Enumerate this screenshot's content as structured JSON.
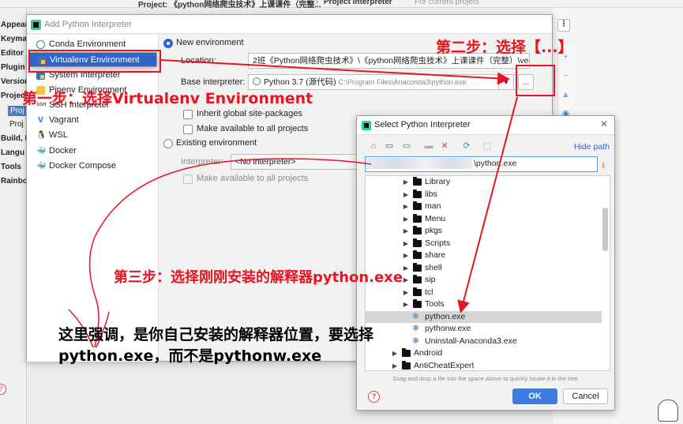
{
  "background": {
    "project_title": "Project: 《python网络爬虫技术》上课课件（完整...",
    "title_separator": "›",
    "project_interpreter_title": "Project Interpreter",
    "for_current_project": "For current project",
    "left_items": [
      "Appear",
      "Keyma",
      "Editor",
      "Plugin",
      "Version",
      "Project",
      "Proj",
      "Proj",
      "Build, E",
      "Langu",
      "Tools",
      "Rainbo"
    ]
  },
  "add_dialog": {
    "title": "Add Python Interpreter",
    "types": [
      {
        "label": "Conda Environment",
        "icon": "conda-icon"
      },
      {
        "label": "Virtualenv Environment",
        "icon": "virtualenv-icon",
        "selected": true
      },
      {
        "label": "System Interpreter",
        "icon": "python-icon"
      },
      {
        "label": "Pipenv Environment",
        "icon": "pipenv-icon"
      },
      {
        "label": "SSH Interpreter",
        "icon": "ssh-icon"
      },
      {
        "label": "Vagrant",
        "icon": "vagrant-icon"
      },
      {
        "label": "WSL",
        "icon": "wsl-icon"
      },
      {
        "label": "Docker",
        "icon": "docker-icon"
      },
      {
        "label": "Docker Compose",
        "icon": "docker-compose-icon"
      }
    ],
    "new_env_label": "New environment",
    "location_label": "Location:",
    "location_value": "2班《Python网络爬虫技术》\\《python网络爬虫技术》上课课件（完整）\\venv",
    "base_interpreter_label": "Base interpreter:",
    "base_interpreter_value": "Python 3.7 (源代码)",
    "base_interpreter_path": "C:\\Program Files\\Anaconda3\\python.exe",
    "browse_label": "...",
    "inherit_label": "Inherit global site-packages",
    "make_available_label": "Make available to all projects",
    "existing_env_label": "Existing environment",
    "interpreter_label": "Interpreter:",
    "interpreter_value": "<No interpreter>",
    "make_available_label_2": "Make available to all projects"
  },
  "select_dialog": {
    "title": "Select Python Interpreter",
    "hide_path_label": "Hide path",
    "path_value": "\\python.exe",
    "tree": [
      {
        "name": "Library",
        "kind": "folder",
        "indent": 1
      },
      {
        "name": "libs",
        "kind": "folder",
        "indent": 1
      },
      {
        "name": "man",
        "kind": "folder",
        "indent": 1
      },
      {
        "name": "Menu",
        "kind": "folder",
        "indent": 1
      },
      {
        "name": "pkgs",
        "kind": "folder",
        "indent": 1
      },
      {
        "name": "Scripts",
        "kind": "folder",
        "indent": 1
      },
      {
        "name": "share",
        "kind": "folder",
        "indent": 1
      },
      {
        "name": "shell",
        "kind": "folder",
        "indent": 1
      },
      {
        "name": "sip",
        "kind": "folder",
        "indent": 1
      },
      {
        "name": "tcl",
        "kind": "folder",
        "indent": 1
      },
      {
        "name": "Tools",
        "kind": "folder",
        "indent": 1
      },
      {
        "name": "python.exe",
        "kind": "file",
        "indent": 1,
        "highlighted": true
      },
      {
        "name": "pythonw.exe",
        "kind": "file",
        "indent": 1
      },
      {
        "name": "Uninstall-Anaconda3.exe",
        "kind": "file",
        "indent": 1
      },
      {
        "name": "Android",
        "kind": "folder",
        "indent": 0
      },
      {
        "name": "AntiCheatExpert",
        "kind": "folder",
        "indent": 0
      }
    ],
    "hint": "Drag and drop a file into the space above to quickly locate it in the tree",
    "ok_label": "OK",
    "cancel_label": "Cancel"
  },
  "annotations": {
    "step1": "第一步：选择Virtualenv Environment",
    "step2": "第二步：选择【...】",
    "step3": "第三步：选择刚刚安装的解释器python.exe",
    "note_line1": "这里强调，是你自己安装的解释器位置，要选择",
    "note_line2": "python.exe，而不是pythonw.exe",
    "color": "#e8141f"
  }
}
